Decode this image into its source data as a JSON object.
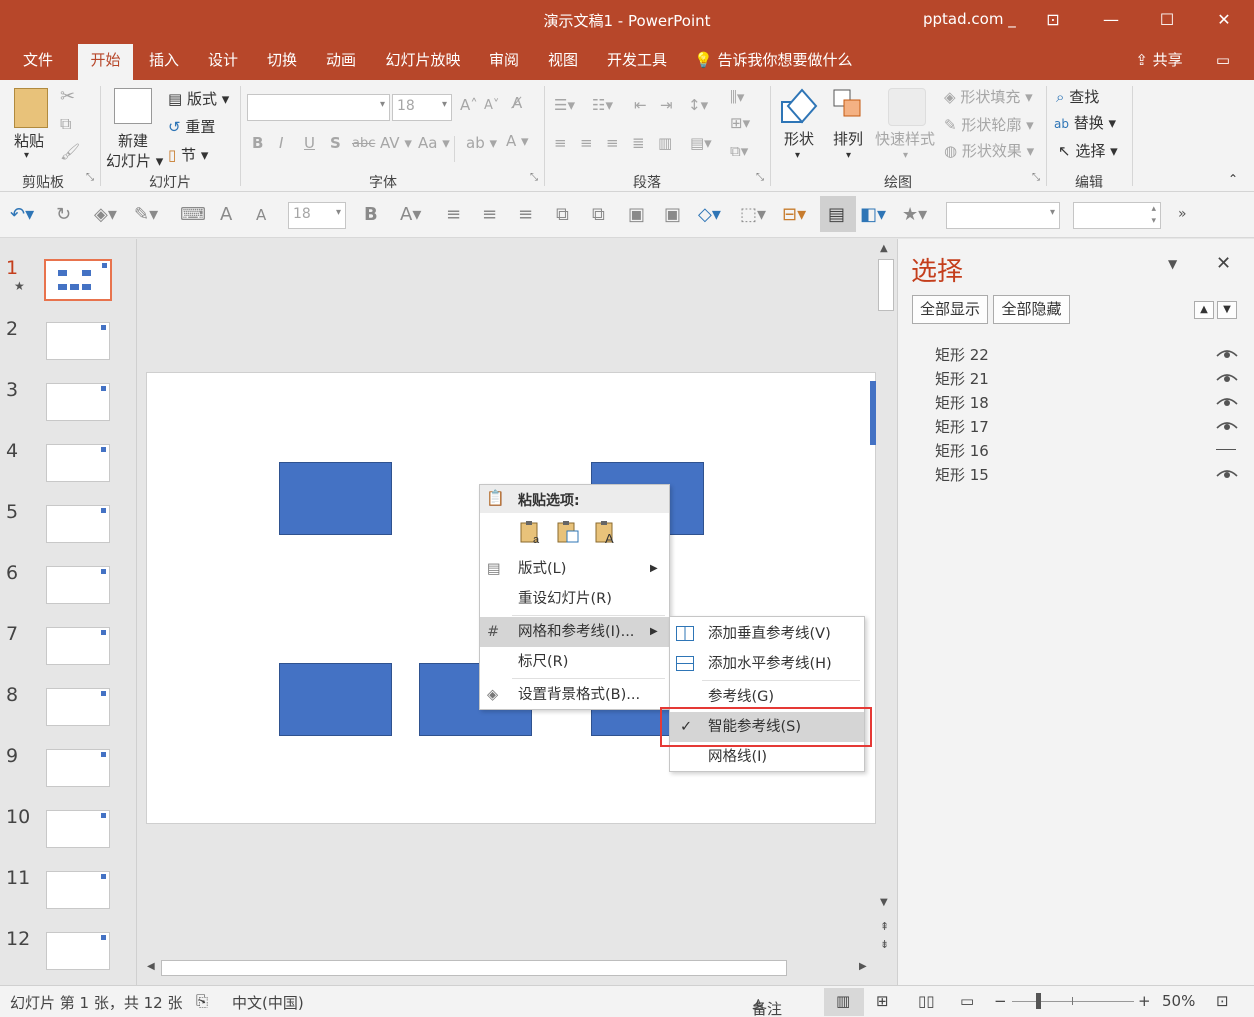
{
  "window": {
    "title": "演示文稿1 - PowerPoint",
    "account": "pptad.com",
    "min_glyph": "—",
    "max_glyph": "☐",
    "close_glyph": "✕",
    "ribbon_opts_glyph": "⊡"
  },
  "tabs": [
    {
      "label": "文件"
    },
    {
      "label": "开始"
    },
    {
      "label": "插入"
    },
    {
      "label": "设计"
    },
    {
      "label": "切换"
    },
    {
      "label": "动画"
    },
    {
      "label": "幻灯片放映"
    },
    {
      "label": "审阅"
    },
    {
      "label": "视图"
    },
    {
      "label": "开发工具"
    }
  ],
  "tell_me": "告诉我你想要做什么",
  "share": "共享",
  "ribbon": {
    "clipboard": {
      "paste": "粘贴",
      "label": "剪贴板"
    },
    "slides": {
      "new_slide_line1": "新建",
      "new_slide_line2": "幻灯片",
      "layout": "版式",
      "reset": "重置",
      "section": "节",
      "label": "幻灯片"
    },
    "font": {
      "size": "18",
      "label": "字体",
      "bold": "B",
      "italic": "I",
      "underline": "U",
      "shadow": "S",
      "strike": "abc",
      "spacing": "AV",
      "case": "Aa",
      "grow": "A",
      "shrink": "A"
    },
    "paragraph": {
      "label": "段落"
    },
    "drawing": {
      "shapes": "形状",
      "arrange": "排列",
      "quick_styles": "快速样式",
      "fill": "形状填充",
      "outline": "形状轮廓",
      "effects": "形状效果",
      "label": "绘图"
    },
    "editing": {
      "find": "查找",
      "replace": "替换",
      "select": "选择",
      "label": "编辑"
    }
  },
  "qat": {
    "font_size": "18"
  },
  "thumbnails": [
    {
      "num": "1"
    },
    {
      "num": "2"
    },
    {
      "num": "3"
    },
    {
      "num": "4"
    },
    {
      "num": "5"
    },
    {
      "num": "6"
    },
    {
      "num": "7"
    },
    {
      "num": "8"
    },
    {
      "num": "9"
    },
    {
      "num": "10"
    },
    {
      "num": "11"
    },
    {
      "num": "12"
    }
  ],
  "context_menu": {
    "paste_header": "粘贴选项:",
    "items": [
      {
        "label": "版式(L)"
      },
      {
        "label": "重设幻灯片(R)"
      },
      {
        "label": "网格和参考线(I)..."
      },
      {
        "label": "标尺(R)"
      },
      {
        "label": "设置背景格式(B)..."
      }
    ]
  },
  "submenu": {
    "items": [
      {
        "label": "添加垂直参考线(V)"
      },
      {
        "label": "添加水平参考线(H)"
      },
      {
        "label": "参考线(G)"
      },
      {
        "label": "智能参考线(S)",
        "checked": true
      },
      {
        "label": "网格线(I)"
      }
    ],
    "check_glyph": "✓",
    "highlight_color": "#e53935"
  },
  "selection_pane": {
    "title": "选择",
    "show_all": "全部显示",
    "hide_all": "全部隐藏",
    "items": [
      {
        "name": "矩形 22",
        "visible": true
      },
      {
        "name": "矩形 21",
        "visible": true
      },
      {
        "name": "矩形 18",
        "visible": true
      },
      {
        "name": "矩形 17",
        "visible": true
      },
      {
        "name": "矩形 16",
        "visible": false
      },
      {
        "name": "矩形 15",
        "visible": true
      }
    ]
  },
  "status": {
    "slide_info": "幻灯片 第 1 张，共 12 张",
    "language": "中文(中国)",
    "notes": "备注",
    "zoom": "50%"
  },
  "colors": {
    "accent": "#b7472a",
    "shape_fill": "#4472c4",
    "active_thumb": "#e8734d"
  }
}
